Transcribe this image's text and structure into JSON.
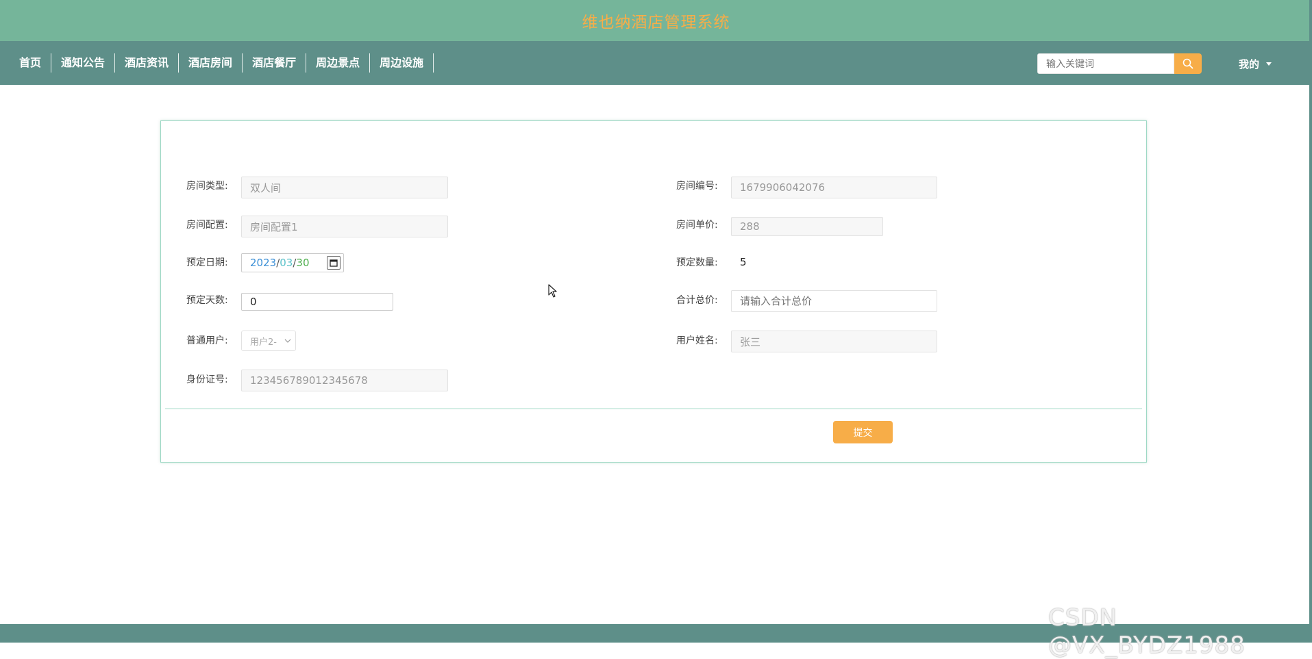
{
  "app_title": "维也纳酒店管理系统",
  "nav": {
    "items": [
      "首页",
      "通知公告",
      "酒店资讯",
      "酒店房间",
      "酒店餐厅",
      "周边景点",
      "周边设施"
    ],
    "search_placeholder": "输入关键词",
    "user_menu_label": "我的"
  },
  "form": {
    "room_type": {
      "label": "房间类型:",
      "value": "双人间"
    },
    "room_number": {
      "label": "房间编号:",
      "value": "1679906042076"
    },
    "room_config": {
      "label": "房间配置:",
      "value": "房间配置1"
    },
    "room_price": {
      "label": "房间单价:",
      "value": "288"
    },
    "booking_date": {
      "label": "预定日期:",
      "year": "2023",
      "month": "03",
      "day": "30",
      "sep": "/"
    },
    "booking_quantity": {
      "label": "预定数量:",
      "value": "5"
    },
    "booking_days": {
      "label": "预定天数:",
      "value": "0"
    },
    "total_price": {
      "label": "合计总价:",
      "placeholder": "请输入合计总价"
    },
    "user": {
      "label": "普通用户:",
      "value": "用户2-"
    },
    "user_name": {
      "label": "用户姓名:",
      "value": "张三"
    },
    "id_number": {
      "label": "身份证号:",
      "value": "123456789012345678"
    },
    "submit_label": "提交"
  },
  "watermark": "CSDN @VX_BYDZ1988",
  "colors": {
    "title_bar": "#75b59a",
    "nav_bar": "#5e8f89",
    "accent_orange": "#f7ad48",
    "card_border": "#9cd8c4"
  }
}
